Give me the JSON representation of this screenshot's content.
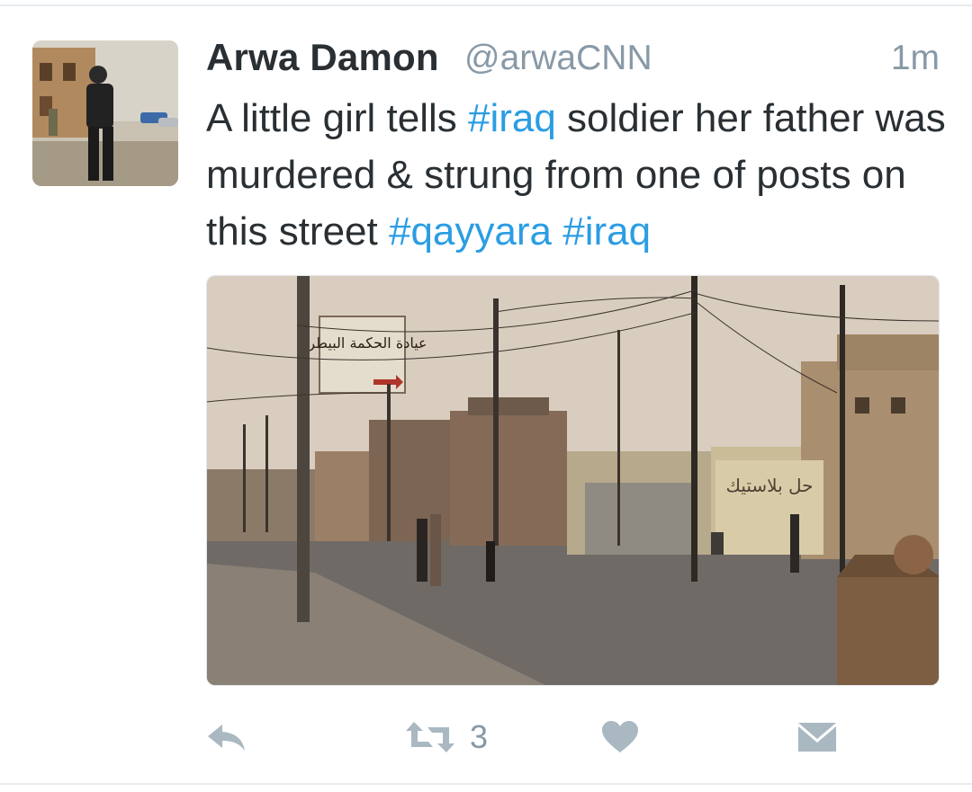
{
  "tweet": {
    "author_name": "Arwa Damon",
    "author_handle": "@arwaCNN",
    "timestamp": "1m",
    "text_segments": [
      {
        "text": "A little girl tells ",
        "type": "text"
      },
      {
        "text": "#iraq",
        "type": "hashtag"
      },
      {
        "text": " soldier her father was murdered & strung from one of posts on this street ",
        "type": "text"
      },
      {
        "text": "#qayyara",
        "type": "hashtag"
      },
      {
        "text": " ",
        "type": "text"
      },
      {
        "text": "#iraq",
        "type": "hashtag"
      }
    ],
    "media": {
      "sign_text": "عيادة الحكمة البيطرية",
      "wall_text": "حل بلاستيك"
    }
  },
  "actions": {
    "reply_icon": "reply-icon",
    "retweet_icon": "retweet-icon",
    "retweet_count": "3",
    "like_icon": "heart-icon",
    "dm_icon": "envelope-icon"
  },
  "colors": {
    "text": "#292f33",
    "muted": "#8899a6",
    "hashtag": "#2b9de3",
    "action_icon": "#aab8c2"
  }
}
